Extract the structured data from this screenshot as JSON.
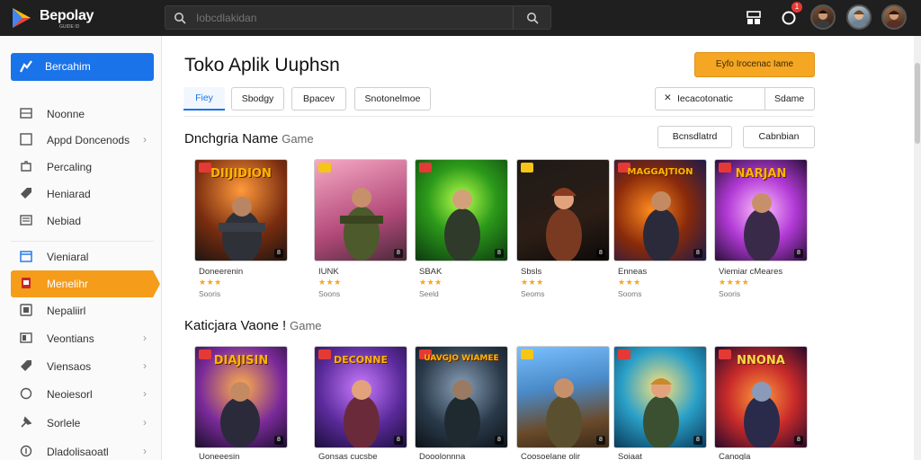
{
  "header": {
    "brand": "Bepolay",
    "brand_sub": "GUIDE ID",
    "search_placeholder": "Iobcdlakidan",
    "icons": [
      "app-grid-icon",
      "notification-icon",
      "avatar"
    ],
    "notification_count": "1"
  },
  "sidebar": {
    "primary_label": "Bercahim",
    "items": [
      {
        "label": "Noonne",
        "chevron": false,
        "icon": "list-icon"
      },
      {
        "label": "Appd Doncenods",
        "chevron": true,
        "icon": "square-icon"
      },
      {
        "label": "Percaling",
        "chevron": false,
        "icon": "puzzle-icon"
      },
      {
        "label": "Heniarad",
        "chevron": false,
        "icon": "tag-icon"
      },
      {
        "label": "Nebiad",
        "chevron": false,
        "icon": "document-icon"
      },
      {
        "label": "Vieniaral",
        "chevron": false,
        "icon": "calendar-icon"
      },
      {
        "label": "Menelihr",
        "chevron": false,
        "icon": "box-icon",
        "active": true
      },
      {
        "label": "Nepaliirl",
        "chevron": false,
        "icon": "folder-icon"
      },
      {
        "label": "Veontians",
        "chevron": true,
        "icon": "bookmark-icon"
      },
      {
        "label": "Viensaos",
        "chevron": true,
        "icon": "tag-icon"
      },
      {
        "label": "Neoiesorl",
        "chevron": true,
        "icon": "circle-icon"
      },
      {
        "label": "Sorlele",
        "chevron": true,
        "icon": "pin-icon"
      },
      {
        "label": "Dladolisaoatl",
        "chevron": true,
        "icon": "circle-icon"
      }
    ]
  },
  "main": {
    "title": "Toko Aplik Uuphsn",
    "cta": "Eyfo Irocenac Iame",
    "tabs": [
      "Fiey",
      "Sbodgy",
      "Bpacev",
      "Snotonelmoe"
    ],
    "filter": {
      "left": "Iecacotonatic",
      "right": "Sdame"
    },
    "sections": [
      {
        "title": "Dnchgria Name",
        "suffix": "Game",
        "buttons": [
          "Bcnsdlatrd",
          "Cabnbian"
        ],
        "cards": [
          {
            "banner": "DIIJIDION",
            "title": "Doneerenin",
            "stars": "★★★",
            "count": "Sooris"
          },
          {
            "banner": "",
            "title": "IUNK",
            "stars": "★★★",
            "count": "Soons"
          },
          {
            "banner": "",
            "title": "SBAK",
            "stars": "★★★",
            "count": "Seeld"
          },
          {
            "banner": "",
            "title": "Sbsls",
            "stars": "★★★",
            "count": "Seoms"
          },
          {
            "banner": "MAGGAJTION",
            "title": "Enneas",
            "stars": "★★★",
            "count": "Sooms"
          },
          {
            "banner": "NARJAN",
            "title": "Viemiar cMeares",
            "stars": "★★★★",
            "count": "Sooris"
          }
        ]
      },
      {
        "title": "Katicjara Vaone !",
        "suffix": "Game",
        "cards": [
          {
            "banner": "DIAJISIN",
            "title": "Uoneeesin",
            "stars": "",
            "count": ""
          },
          {
            "banner": "DECONNE",
            "title": "Gonsas cucsbe",
            "stars": "",
            "count": ""
          },
          {
            "banner": "UAVGJO WIAMEE",
            "title": "Dooolonnna",
            "stars": "",
            "count": ""
          },
          {
            "banner": "",
            "title": "Coosoelane olir",
            "stars": "",
            "count": ""
          },
          {
            "banner": "",
            "title": "Soiaat",
            "stars": "",
            "count": ""
          },
          {
            "banner": "NNONA",
            "title": "Canogla",
            "stars": "",
            "count": ""
          }
        ]
      }
    ]
  },
  "colors": {
    "topbar": "#1f1f1f",
    "primary": "#1a73e8",
    "accent": "#f59c1a",
    "cta": "#f5a623",
    "star": "#f5a623"
  }
}
